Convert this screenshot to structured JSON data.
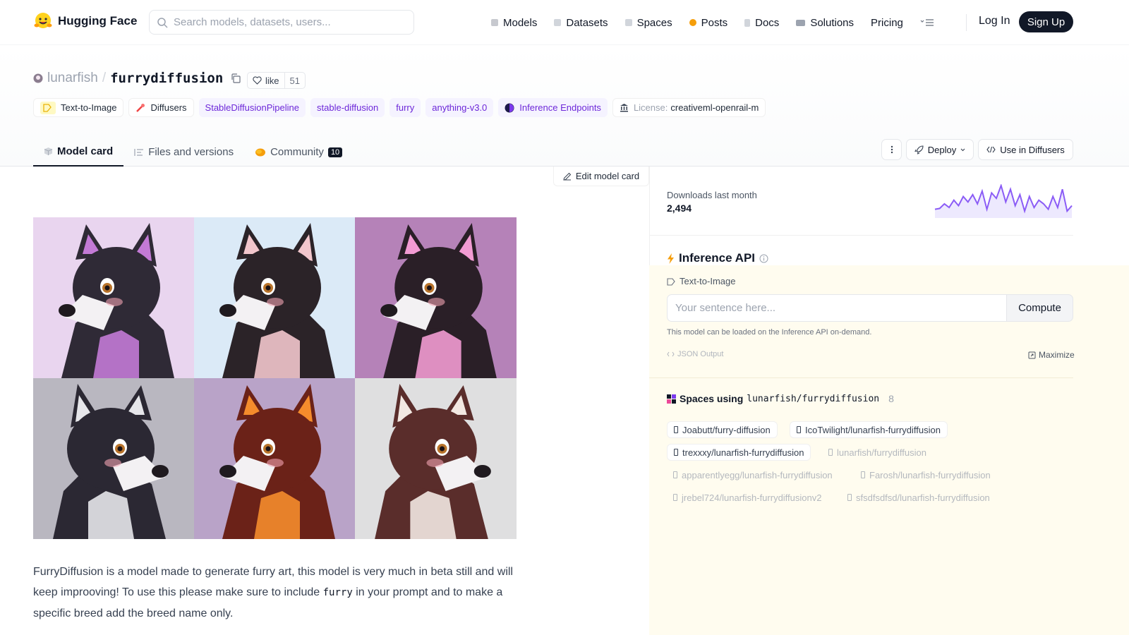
{
  "nav": {
    "brand": "Hugging Face",
    "search_placeholder": "Search models, datasets, users...",
    "items": [
      {
        "label": "Models",
        "color": "#c7c9cf"
      },
      {
        "label": "Datasets",
        "color": "#d1d5db"
      },
      {
        "label": "Spaces",
        "color": "#d1d5db"
      },
      {
        "label": "Posts",
        "color": "#f59e0b"
      },
      {
        "label": "Docs",
        "color": "#d1d5db"
      },
      {
        "label": "Solutions",
        "color": "#9ca3af"
      },
      {
        "label": "Pricing",
        "color": ""
      }
    ],
    "login": "Log In",
    "signup": "Sign Up"
  },
  "repo": {
    "owner": "lunarfish",
    "separator": "/",
    "name": "furrydiffusion",
    "like_label": "like",
    "like_count": "51"
  },
  "tags": [
    {
      "label": "Text-to-Image",
      "icon": "text-to-image-icon"
    },
    {
      "label": "Diffusers",
      "icon": "diffusers-icon"
    },
    {
      "label": "StableDiffusionPipeline"
    },
    {
      "label": "stable-diffusion"
    },
    {
      "label": "furry"
    },
    {
      "label": "anything-v3.0"
    },
    {
      "label": "Inference Endpoints",
      "icon": "inference-endpoints-icon"
    }
  ],
  "license": {
    "prefix": "License:",
    "value": "creativeml-openrail-m"
  },
  "tabs": [
    {
      "label": "Model card",
      "active": true
    },
    {
      "label": "Files and versions"
    },
    {
      "label": "Community",
      "badge": "10"
    }
  ],
  "actions": {
    "deploy": "Deploy",
    "use_in": "Use in Diffusers"
  },
  "edit_card": "Edit model card",
  "gallery": [
    {
      "bg": "#e9d5ef",
      "fur": "#2f2a36",
      "accent": "#c37ad6"
    },
    {
      "bg": "#dbeaf7",
      "fur": "#2b2328",
      "accent": "#f2c6cc"
    },
    {
      "bg": "#b582b8",
      "fur": "#2a1f27",
      "accent": "#f29bd3"
    },
    {
      "bg": "#b9b7c0",
      "fur": "#2b2833",
      "accent": "#e6e6ea"
    },
    {
      "bg": "#b9a3c8",
      "fur": "#6b2218",
      "accent": "#f58c2c"
    },
    {
      "bg": "#dfdfe0",
      "fur": "#5a2d2b",
      "accent": "#f2e8e2"
    }
  ],
  "description": {
    "part1": "FurryDiffusion is a model made to generate furry art, this model is very much in beta still and will keep improoving! To use this please make sure to include ",
    "code": "furry",
    "part2": " in your prompt and to make a specific breed add the breed name only."
  },
  "downloads": {
    "label": "Downloads last month",
    "value": "2,494",
    "series": [
      8,
      9,
      14,
      10,
      18,
      12,
      22,
      16,
      24,
      14,
      28,
      8,
      26,
      20,
      34,
      16,
      30,
      12,
      24,
      6,
      22,
      10,
      18,
      14,
      8,
      22,
      10,
      30,
      6,
      12
    ]
  },
  "inference": {
    "title": "Inference API",
    "task": "Text-to-Image",
    "placeholder": "Your sentence here...",
    "compute": "Compute",
    "note": "This model can be loaded on the Inference API on-demand.",
    "json_output": "JSON Output",
    "maximize": "Maximize"
  },
  "spaces": {
    "label": "Spaces using",
    "repo": "lunarfish/furrydiffusion",
    "count": "8",
    "items": [
      {
        "label": "Joabutt/furry-diffusion",
        "active": true
      },
      {
        "label": "IcoTwilight/lunarfish-furrydiffusion",
        "active": true
      },
      {
        "label": "trexxxy/lunarfish-furrydiffusion",
        "active": true
      },
      {
        "label": "lunarfish/furrydiffusion",
        "active": false
      },
      {
        "label": "apparentlyegg/lunarfish-furrydiffusion",
        "active": false
      },
      {
        "label": "Farosh/lunarfish-furrydiffusion",
        "active": false
      },
      {
        "label": "jrebel724/lunarfish-furrydiffusionv2",
        "active": false
      },
      {
        "label": "sfsdfsdfsd/lunarfish-furrydiffusion",
        "active": false
      }
    ]
  }
}
